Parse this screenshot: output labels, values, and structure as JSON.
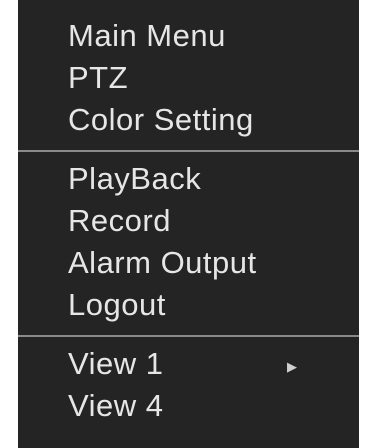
{
  "menu": {
    "group1": [
      {
        "label": "Main Menu"
      },
      {
        "label": "PTZ"
      },
      {
        "label": "Color Setting"
      }
    ],
    "group2": [
      {
        "label": "PlayBack"
      },
      {
        "label": "Record"
      },
      {
        "label": "Alarm Output"
      },
      {
        "label": "Logout"
      }
    ],
    "group3": [
      {
        "label": "View 1",
        "submenu_icon": "triangle-right-icon"
      },
      {
        "label": "View 4"
      }
    ]
  },
  "colors": {
    "background": "#242424",
    "text": "#e6e6e6",
    "divider": "#8a8a8a"
  }
}
